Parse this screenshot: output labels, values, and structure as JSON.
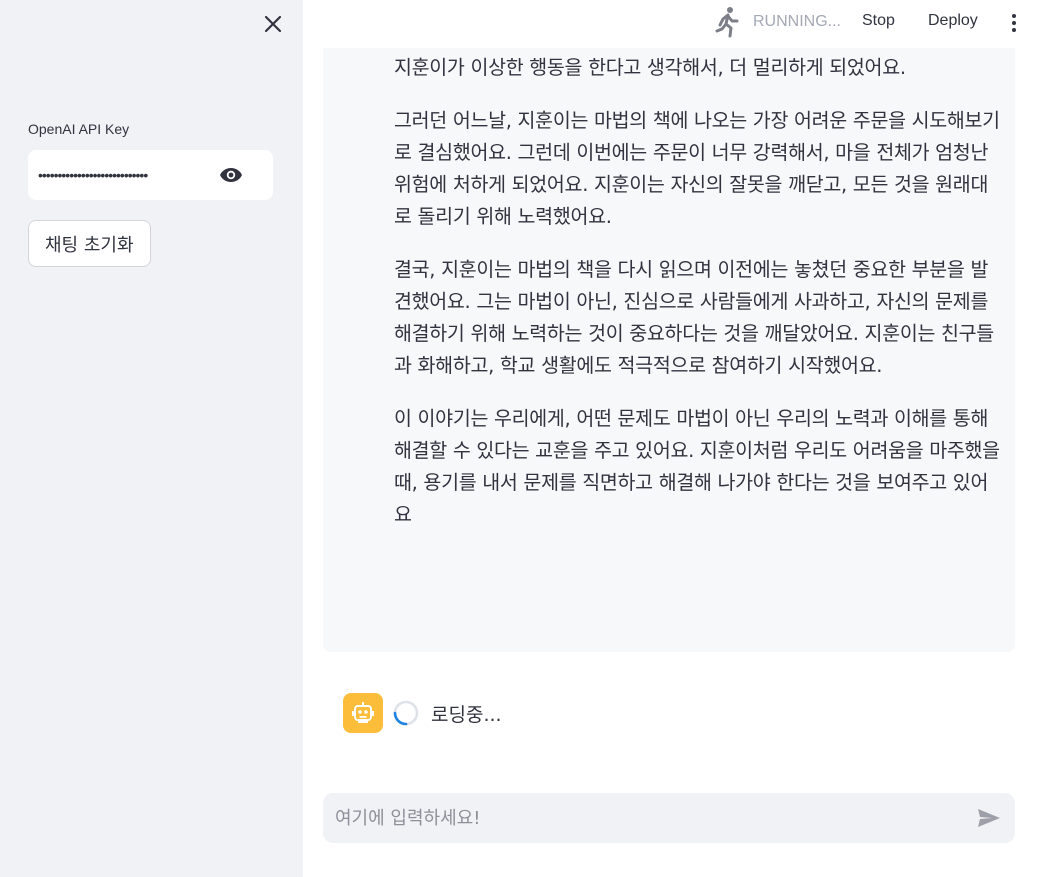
{
  "sidebar": {
    "close_icon": "close-icon",
    "api_key_label": "OpenAI API Key",
    "api_key_value": "••••••••••••••••••••••••••••",
    "visibility_icon": "eye-icon",
    "reset_button_label": "채팅 초기화"
  },
  "header": {
    "status_icon": "running-man-icon",
    "status_text": "RUNNING...",
    "stop_label": "Stop",
    "deploy_label": "Deploy",
    "menu_icon": "kebab-menu-icon"
  },
  "chat": {
    "assistant_paragraphs": [
      "우리의 능력을 위해 마법을 사용하게 되었어요. 그런데 마법의 힘을 잘못 사용해서, 자기도 모르게 주변 사람들을 곤란에 빠트리기 시작했어요. 친구들은 지훈이가 이상한 행동을 한다고 생각해서, 더 멀리하게 되었어요.",
      "그러던 어느날, 지훈이는 마법의 책에 나오는 가장 어려운 주문을 시도해보기로 결심했어요. 그런데 이번에는 주문이 너무 강력해서, 마을 전체가 엄청난 위험에 처하게 되었어요. 지훈이는 자신의 잘못을 깨닫고, 모든 것을 원래대로 돌리기 위해 노력했어요.",
      "결국, 지훈이는 마법의 책을 다시 읽으며 이전에는 놓쳤던 중요한 부분을 발견했어요. 그는 마법이 아닌, 진심으로 사람들에게 사과하고, 자신의 문제를 해결하기 위해 노력하는 것이 중요하다는 것을 깨달았어요. 지훈이는 친구들과 화해하고, 학교 생활에도 적극적으로 참여하기 시작했어요.",
      "이 이야기는 우리에게, 어떤 문제도 마법이 아닌 우리의 노력과 이해를 통해 해결할 수 있다는 교훈을 주고 있어요. 지훈이처럼 우리도 어려움을 마주했을 때, 용기를 내서 문제를 직면하고 해결해 나가야 한다는 것을 보여주고 있어요"
    ],
    "bot_avatar_icon": "robot-icon",
    "loading_text": "로딩중...",
    "input_placeholder": "여기에 입력하세요!",
    "send_icon": "send-icon"
  },
  "colors": {
    "sidebar_bg": "#f0f2f6",
    "message_bg": "#f7f8fa",
    "bot_avatar": "#fbbd3a",
    "spinner_accent": "#1c83e1",
    "text": "#31333f"
  }
}
